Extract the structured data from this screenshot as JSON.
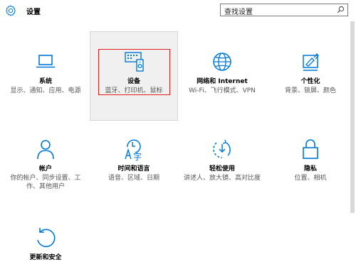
{
  "header": {
    "title": "设置",
    "search_placeholder": "查找设置"
  },
  "tiles": [
    {
      "name": "系统",
      "desc": "显示、通知、应用、电源",
      "icon": "laptop-icon"
    },
    {
      "name": "设备",
      "desc": "蓝牙、打印机、鼠标",
      "icon": "devices-icon"
    },
    {
      "name": "网络和 Internet",
      "desc": "Wi-Fi、飞行模式、VPN",
      "icon": "globe-icon"
    },
    {
      "name": "个性化",
      "desc": "背景、锁屏、颜色",
      "icon": "paint-icon"
    },
    {
      "name": "帐户",
      "desc": "你的帐户、同步设置、工作、其他用户",
      "icon": "person-icon"
    },
    {
      "name": "时间和语言",
      "desc": "语音、区域、日期",
      "icon": "time-language-icon"
    },
    {
      "name": "轻松使用",
      "desc": "讲述人、放大镜、高对比度",
      "icon": "ease-of-access-icon"
    },
    {
      "name": "隐私",
      "desc": "位置、相机",
      "icon": "lock-icon"
    },
    {
      "name": "更新和安全",
      "desc": "",
      "icon": "refresh-icon"
    }
  ],
  "colors": {
    "accent": "#0078d7",
    "focus": "#e01e1e"
  }
}
